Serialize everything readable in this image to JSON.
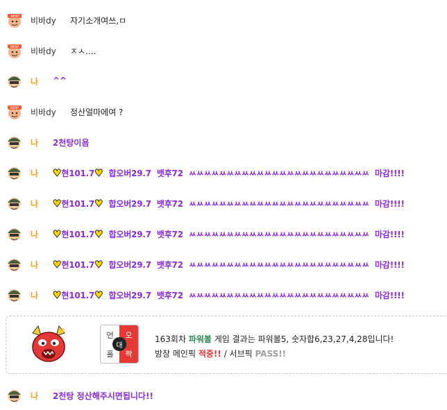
{
  "messages": [
    {
      "type": "other",
      "name": "비바dy",
      "text": "자기소개여쓰,ㅁ"
    },
    {
      "type": "other",
      "name": "비바dy",
      "text": "ㅈㅅ...."
    },
    {
      "type": "me",
      "name": "나",
      "text": "^^"
    },
    {
      "type": "other",
      "name": "비바dy",
      "text": "정산얼마에여 ?"
    },
    {
      "type": "me",
      "name": "나",
      "text": "2천탕이욤"
    },
    {
      "type": "me_spam",
      "name": "나",
      "prefix": "현101.7",
      "mid1": "합오버29.7",
      "mid2": "뱃후72",
      "tail": "ㅆㅆㅆㅆㅆㅆㅆㅆㅆㅆㅆㅆㅆㅆㅆㅆㅆㅆㅆㅆㅆㅆㅆㅆ",
      "end": "마감!!!!"
    },
    {
      "type": "me_spam",
      "name": "나",
      "prefix": "현101.7",
      "mid1": "합오버29.7",
      "mid2": "뱃후72",
      "tail": "ㅆㅆㅆㅆㅆㅆㅆㅆㅆㅆㅆㅆㅆㅆㅆㅆㅆㅆㅆㅆㅆㅆㅆㅆ",
      "end": "마감!!!!"
    },
    {
      "type": "me_spam",
      "name": "나",
      "prefix": "현101.7",
      "mid1": "합오버29.7",
      "mid2": "뱃후72",
      "tail": "ㅆㅆㅆㅆㅆㅆㅆㅆㅆㅆㅆㅆㅆㅆㅆㅆㅆㅆㅆㅆㅆㅆㅆㅆ",
      "end": "마감!!!!"
    },
    {
      "type": "me_spam",
      "name": "나",
      "prefix": "현101.7",
      "mid1": "합오버29.7",
      "mid2": "뱃후72",
      "tail": "ㅆㅆㅆㅆㅆㅆㅆㅆㅆㅆㅆㅆㅆㅆㅆㅆㅆㅆㅆㅆㅆㅆㅆㅆ",
      "end": "마감!!!!"
    },
    {
      "type": "me_spam",
      "name": "나",
      "prefix": "현101.7",
      "mid1": "합오버29.7",
      "mid2": "뱃후72",
      "tail": "ㅆㅆㅆㅆㅆㅆㅆㅆㅆㅆㅆㅆㅆㅆㅆㅆㅆㅆㅆㅆㅆㅆㅆㅆ",
      "end": "마감!!!!"
    }
  ],
  "result_card": {
    "icon": "devil-icon",
    "odd_even": {
      "tl": "언",
      "tr": "오",
      "bl": "홀",
      "br": "짝",
      "center": "대"
    },
    "line1_a": "163회차 ",
    "line1_game": "파워볼",
    "line1_b": " 게임 결과는 파워볼5, 숫자합6,23,27,4,28입니다!",
    "line2_a": "방장 메인픽 ",
    "line2_hit": "적중!!",
    "line2_b": " / 서브픽 ",
    "line2_pass": "PASS!!"
  },
  "last_message": {
    "type": "me",
    "name": "나",
    "text": "2천탕 정산해주시면됩니다!!"
  },
  "colors": {
    "me_name": "#f0a020",
    "me_text": "#8a2be2",
    "heart": "#ffd700",
    "hit": "#e53935",
    "game": "#2e8b57"
  }
}
